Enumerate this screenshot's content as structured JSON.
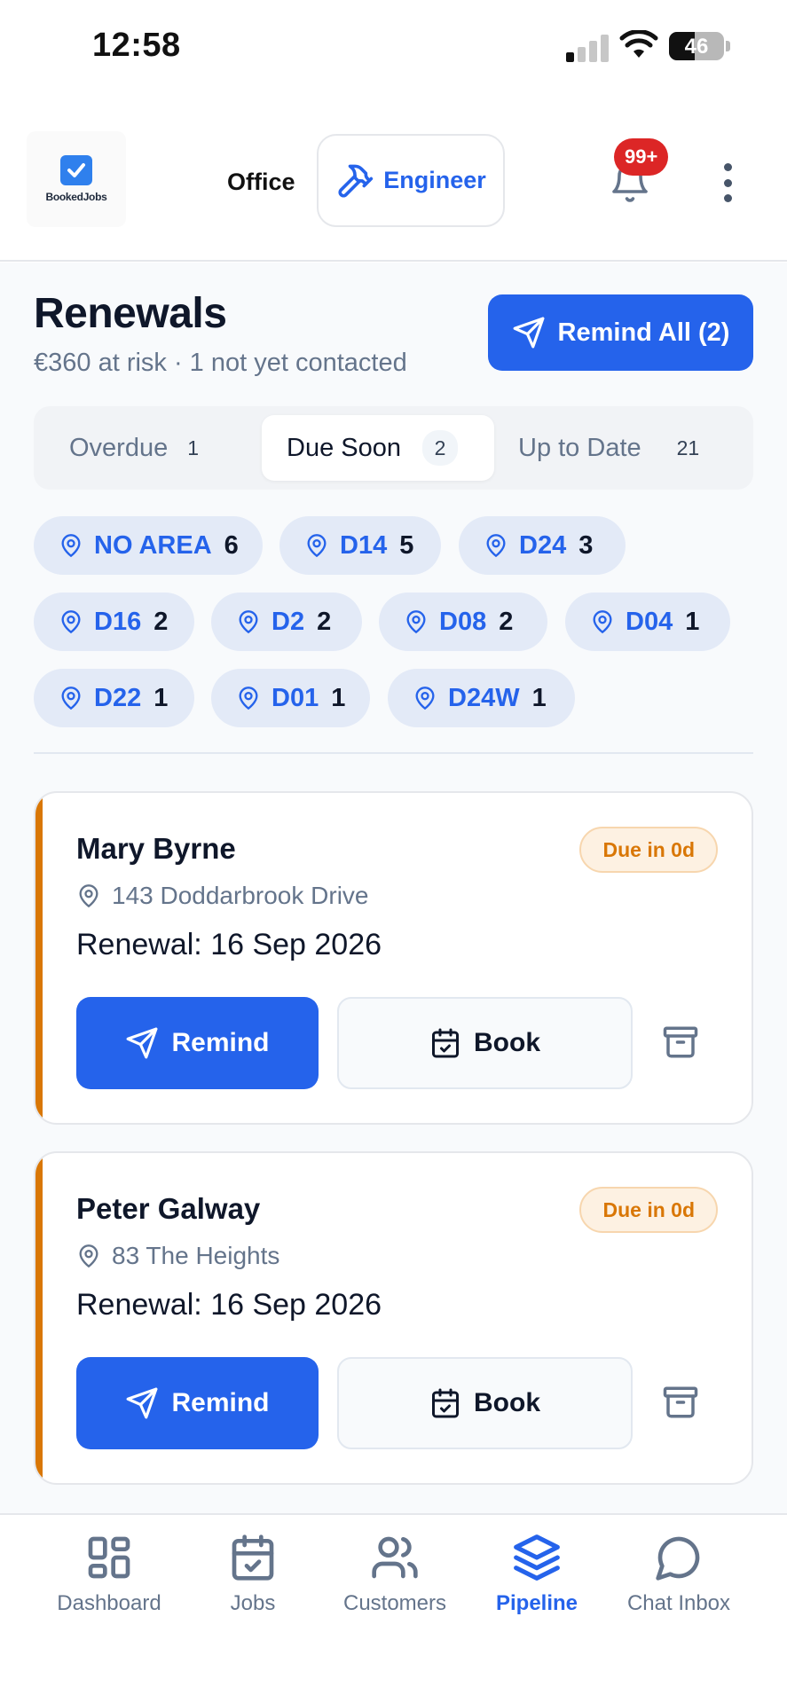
{
  "status_bar": {
    "time": "12:58",
    "battery": "46",
    "battery_level": 0.46
  },
  "header": {
    "logo_text": "BookedJobs",
    "mode_office": "Office",
    "mode_engineer": "Engineer",
    "notification_count": "99+"
  },
  "renewals": {
    "title": "Renewals",
    "subtitle": "€360 at risk · 1 not yet contacted",
    "remind_all_label": "Remind All (2)",
    "tabs": [
      {
        "label": "Overdue",
        "count": "1"
      },
      {
        "label": "Due Soon",
        "count": "2"
      },
      {
        "label": "Up to Date",
        "count": "21"
      }
    ],
    "areas": [
      {
        "label": "NO AREA",
        "count": "6"
      },
      {
        "label": "D14",
        "count": "5"
      },
      {
        "label": "D24",
        "count": "3"
      },
      {
        "label": "D16",
        "count": "2"
      },
      {
        "label": "D2",
        "count": "2"
      },
      {
        "label": "D08",
        "count": "2"
      },
      {
        "label": "D04",
        "count": "1"
      },
      {
        "label": "D22",
        "count": "1"
      },
      {
        "label": "D01",
        "count": "1"
      },
      {
        "label": "D24W",
        "count": "1"
      }
    ],
    "cards": [
      {
        "name": "Mary Byrne",
        "due": "Due in 0d",
        "address": "143 Doddarbrook Drive",
        "renewal": "Renewal: 16 Sep 2026",
        "remind_label": "Remind",
        "book_label": "Book"
      },
      {
        "name": "Peter Galway",
        "due": "Due in 0d",
        "address": "83 The Heights",
        "renewal": "Renewal: 16 Sep 2026",
        "remind_label": "Remind",
        "book_label": "Book"
      }
    ]
  },
  "nav": [
    {
      "label": "Dashboard"
    },
    {
      "label": "Jobs"
    },
    {
      "label": "Customers"
    },
    {
      "label": "Pipeline"
    },
    {
      "label": "Chat Inbox"
    }
  ],
  "colors": {
    "accent": "#2563eb",
    "warning": "#d97706",
    "danger": "#dc2626"
  }
}
